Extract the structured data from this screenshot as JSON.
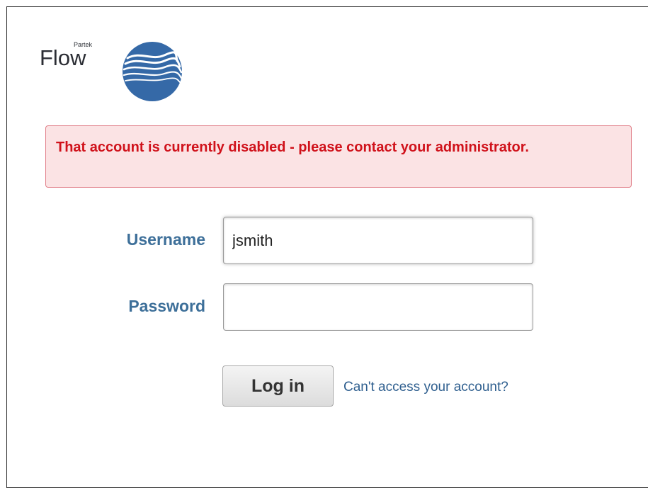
{
  "logo": {
    "brand_small": "Partek",
    "brand_main": "Flow"
  },
  "alert": {
    "message": "That account is currently disabled - please contact your administrator."
  },
  "form": {
    "username_label": "Username",
    "username_value": "jsmith",
    "password_label": "Password",
    "password_value": "",
    "login_label": "Log in",
    "forgot_label": "Can't access your account?"
  },
  "colors": {
    "alert_background": "#fbe3e4",
    "alert_text": "#d0121b",
    "label_text": "#3d6f99",
    "link_text": "#2f5f8f",
    "logo_blue": "#3569a7"
  }
}
